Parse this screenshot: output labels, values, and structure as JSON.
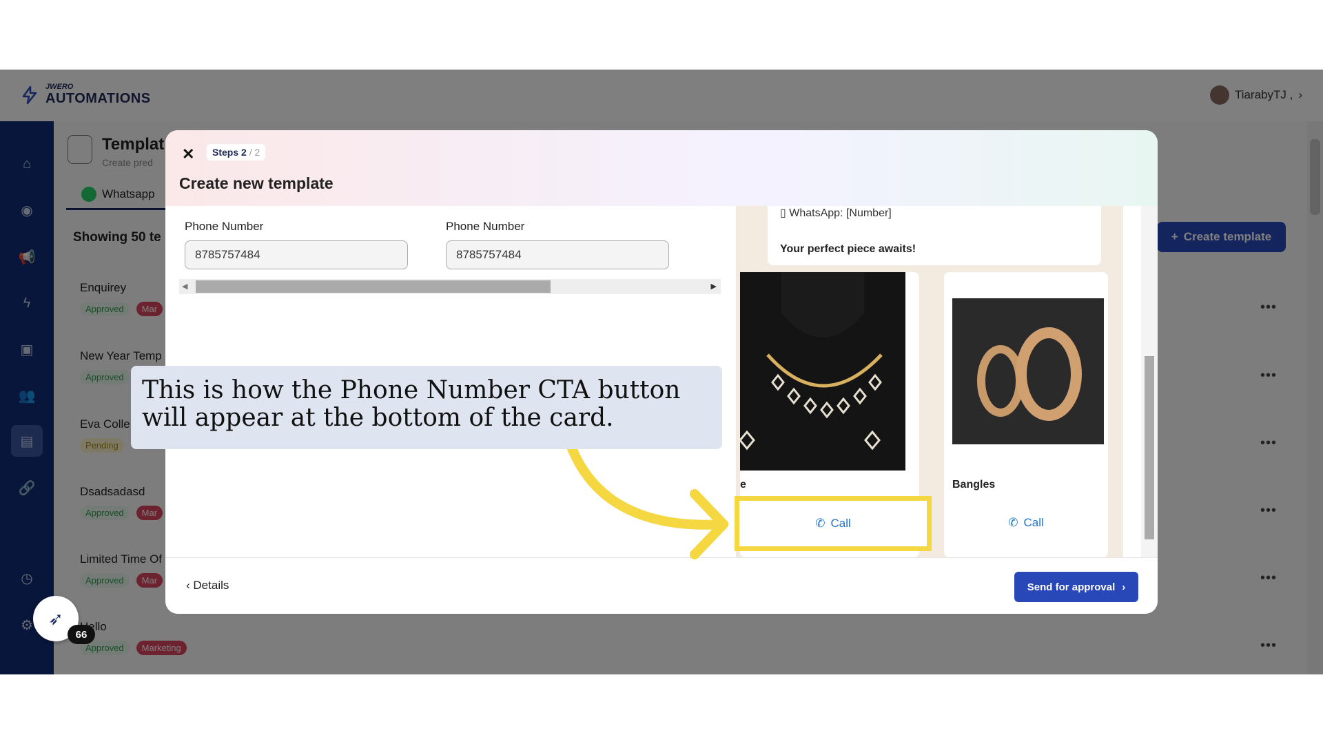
{
  "header": {
    "logo_top": "JWERO",
    "logo_main": "AUTOMATIONS",
    "user_name": "TiarabyTJ ,"
  },
  "page": {
    "title": "Templat",
    "subtitle": "Create pred",
    "tab_whatsapp": "Whatsapp",
    "showing": "Showing 50 te",
    "create_button": "Create template"
  },
  "templates": [
    {
      "name": "Enquirey",
      "status": "Approved",
      "tag": "Mar"
    },
    {
      "name": "New Year Temp",
      "status": "Approved",
      "tag": ""
    },
    {
      "name": "Eva Colle",
      "status": "Pending",
      "tag": ""
    },
    {
      "name": "Dsadsadasd",
      "status": "Approved",
      "tag": "Mar"
    },
    {
      "name": "Limited Time Of",
      "status": "Approved",
      "tag": "Mar"
    },
    {
      "name": "Hello",
      "status": "Approved",
      "tag": "Marketing"
    }
  ],
  "modal": {
    "steps_label": "Steps 2",
    "steps_total": "/ 2",
    "title": "Create new template",
    "fields": [
      {
        "label": "Phone Number",
        "value": "8785757484"
      },
      {
        "label": "Phone Number",
        "value": "8785757484"
      }
    ],
    "preview": {
      "wa_line": "WhatsApp: [Number]",
      "cta_line": "Your perfect piece awaits!",
      "cards": [
        {
          "title": "e",
          "button": "Call"
        },
        {
          "title": "Bangles",
          "button": "Call"
        }
      ]
    },
    "back_label": "Details",
    "approve_label": "Send for approval"
  },
  "callout": {
    "text": "This is how the Phone Number CTA button will appear at the bottom of the card."
  },
  "widget": {
    "count": "66"
  },
  "colors": {
    "brand": "#1b2a6b",
    "sidebar": "#0f2c75",
    "accent_button": "#2848b8",
    "highlight": "#f5d742",
    "call_link": "#1d73c9"
  },
  "icons": [
    "home-icon",
    "broadcast-icon",
    "megaphone-icon",
    "bolt-icon",
    "bot-icon",
    "users-icon",
    "document-icon",
    "link-icon",
    "clock-icon",
    "gear-icon",
    "phone-icon",
    "rocket-icon"
  ]
}
